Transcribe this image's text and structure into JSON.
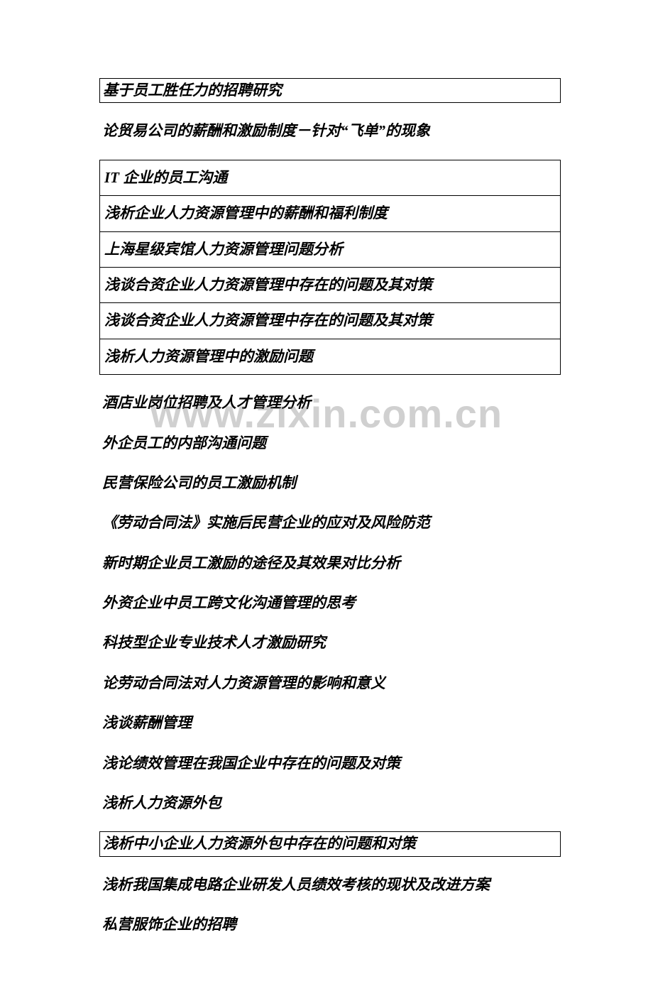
{
  "watermark": "www.zixin.com.cn",
  "lines": [
    {
      "text": "基于员工胜任力的招聘研究",
      "boxed": true
    },
    {
      "text": "论贸易公司的薪酬和激励制度－针对“飞单”的现象",
      "boxed": false
    },
    {
      "text": "IT 企业的员工沟通",
      "boxed": false,
      "groupStart": true
    },
    {
      "text": "浅析企业人力资源管理中的薪酬和福利制度",
      "boxed": false,
      "groupItem": true
    },
    {
      "text": "上海星级宾馆人力资源管理问题分析",
      "boxed": false,
      "groupItem": true
    },
    {
      "text": "浅谈合资企业人力资源管理中存在的问题及其对策",
      "boxed": false,
      "groupItem": true
    },
    {
      "text": "浅谈合资企业人力资源管理中存在的问题及其对策",
      "boxed": false,
      "groupItem": true
    },
    {
      "text": "浅析人力资源管理中的激励问题",
      "boxed": false,
      "groupEnd": true
    },
    {
      "text": "酒店业岗位招聘及人才管理分析",
      "boxed": false
    },
    {
      "text": "外企员工的内部沟通问题",
      "boxed": false
    },
    {
      "text": "民营保险公司的员工激励机制",
      "boxed": false
    },
    {
      "text": "《劳动合同法》实施后民营企业的应对及风险防范",
      "boxed": false
    },
    {
      "text": "新时期企业员工激励的途径及其效果对比分析",
      "boxed": false
    },
    {
      "text": "外资企业中员工跨文化沟通管理的思考",
      "boxed": false
    },
    {
      "text": "科技型企业专业技术人才激励研究",
      "boxed": false
    },
    {
      "text": "论劳动合同法对人力资源管理的影响和意义",
      "boxed": false
    },
    {
      "text": "浅谈薪酬管理",
      "boxed": false
    },
    {
      "text": "浅论绩效管理在我国企业中存在的问题及对策",
      "boxed": false
    },
    {
      "text": "浅析人力资源外包",
      "boxed": false
    },
    {
      "text": "浅析中小企业人力资源外包中存在的问题和对策",
      "boxed": true
    },
    {
      "text": "浅析我国集成电路企业研发人员绩效考核的现状及改进方案",
      "boxed": false
    },
    {
      "text": "私营服饰企业的招聘",
      "boxed": false
    }
  ]
}
